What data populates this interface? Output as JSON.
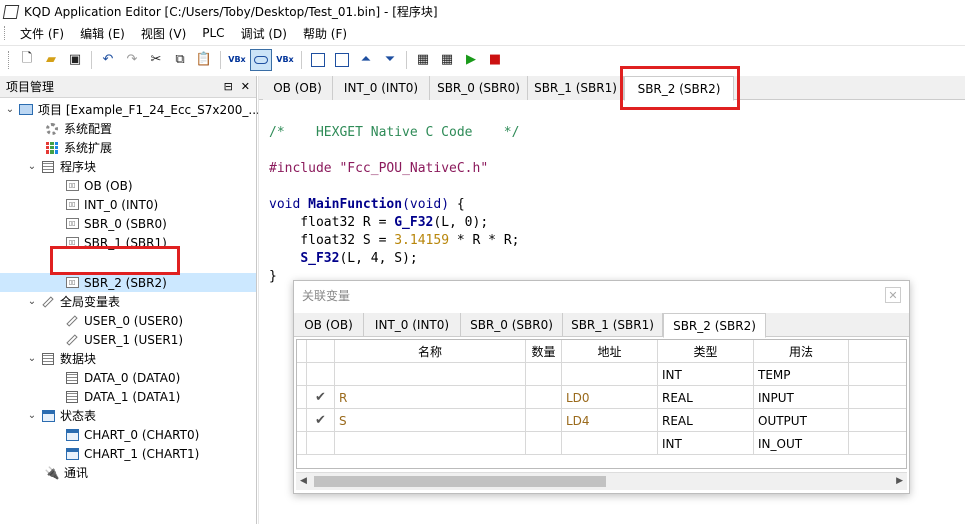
{
  "window": {
    "title": "KQD Application Editor [C:/Users/Toby/Desktop/Test_01.bin] - [程序块]"
  },
  "menu": [
    "文件 (F)",
    "编辑 (E)",
    "视图 (V)",
    "PLC",
    "调试 (D)",
    "帮助 (F)"
  ],
  "left_panel": {
    "title": "项目管理",
    "pin": "⊟",
    "close": "✕",
    "tree": [
      {
        "label": "项目 [Example_F1_24_Ecc_S7x200_...",
        "icon": "pc-icon"
      },
      {
        "label": "系统配置",
        "icon": "gear-icon"
      },
      {
        "label": "系统扩展",
        "icon": "grid-icon"
      },
      {
        "label": "程序块",
        "icon": "db-icon"
      },
      {
        "label": "OB (OB)",
        "icon": "program-icon"
      },
      {
        "label": "INT_0 (INT0)",
        "icon": "program-icon"
      },
      {
        "label": "SBR_0 (SBR0)",
        "icon": "program-icon"
      },
      {
        "label": "SBR_1 (SBR1)",
        "icon": "program-icon"
      },
      {
        "label": "SBR_2 (SBR2)",
        "icon": "program-icon"
      },
      {
        "label": "全局变量表",
        "icon": "variable-icon"
      },
      {
        "label": "USER_0 (USER0)",
        "icon": "variable-icon"
      },
      {
        "label": "USER_1 (USER1)",
        "icon": "variable-icon"
      },
      {
        "label": "数据块",
        "icon": "db-icon"
      },
      {
        "label": "DATA_0 (DATA0)",
        "icon": "db-icon"
      },
      {
        "label": "DATA_1 (DATA1)",
        "icon": "db-icon"
      },
      {
        "label": "状态表",
        "icon": "table-icon"
      },
      {
        "label": "CHART_0 (CHART0)",
        "icon": "table-icon"
      },
      {
        "label": "CHART_1 (CHART1)",
        "icon": "table-icon"
      },
      {
        "label": "通讯",
        "icon": "plug-icon"
      }
    ]
  },
  "editor": {
    "tabs": [
      "OB (OB)",
      "INT_0 (INT0)",
      "SBR_0 (SBR0)",
      "SBR_1 (SBR1)",
      "SBR_2 (SBR2)"
    ],
    "active_tab": "SBR_2 (SBR2)",
    "code": {
      "comment": "/*    HEXGET Native C Code    */",
      "include_kw": "#include",
      "include_file": "\"Fcc_POU_NativeC.h\"",
      "fn_type": "void",
      "fn_name": "MainFunction",
      "fn_args": "(void)",
      "fn_open": " {",
      "line1_a": "    float32 R = ",
      "line1_fn": "G_F32",
      "line1_b": "(L, 0);",
      "line2_a": "    float32 S = ",
      "line2_num": "3.14159",
      "line2_b": " * R * R;",
      "line3_fn": "S_F32",
      "line3_b": "(L, 4, S);",
      "close": "}"
    }
  },
  "popup": {
    "title": "关联变量",
    "close": "✕",
    "tabs": [
      "OB (OB)",
      "INT_0 (INT0)",
      "SBR_0 (SBR0)",
      "SBR_1 (SBR1)",
      "SBR_2 (SBR2)"
    ],
    "active_tab": "SBR_2 (SBR2)",
    "columns": [
      "",
      "名称",
      "数量",
      "地址",
      "类型",
      "用法"
    ],
    "rows": [
      {
        "check": "",
        "name": "",
        "count": "",
        "address": "",
        "type": "INT",
        "usage": "TEMP"
      },
      {
        "check": "✔",
        "name": "R",
        "count": "",
        "address": "LD0",
        "type": "REAL",
        "usage": "INPUT"
      },
      {
        "check": "✔",
        "name": "S",
        "count": "",
        "address": "LD4",
        "type": "REAL",
        "usage": "OUTPUT"
      },
      {
        "check": "",
        "name": "",
        "count": "",
        "address": "",
        "type": "INT",
        "usage": "IN_OUT"
      }
    ]
  },
  "colors": {
    "highlight_box": "#e02020",
    "selected_row": "#cce8ff"
  }
}
